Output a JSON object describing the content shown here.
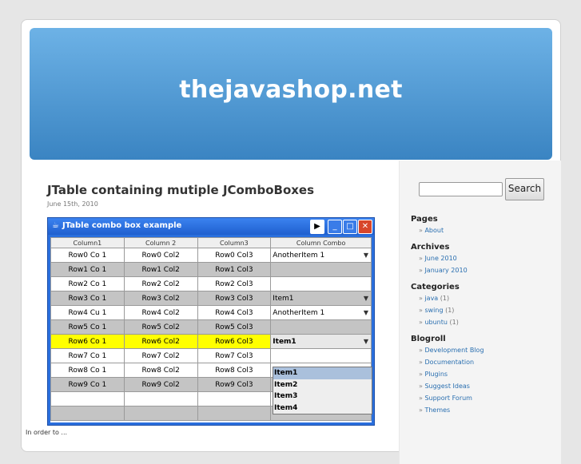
{
  "site": {
    "title": "thejavashop.net"
  },
  "post": {
    "title": "JTable containing mutiple JComboBoxes",
    "date": "June 15th, 2010",
    "body_excerpt": "In  order  to ..."
  },
  "app_window": {
    "title": "JTable combo box example",
    "columns": [
      "Column1",
      "Column 2",
      "Column3",
      "Column Combo"
    ],
    "rows": [
      [
        "Row0 Co 1",
        "Row0 Col2",
        "Row0 Col3",
        "AnotherItem 1"
      ],
      [
        "Row1 Co 1",
        "Row1 Col2",
        "Row1 Col3",
        ""
      ],
      [
        "Row2 Co 1",
        "Row2 Col2",
        "Row2 Col3",
        ""
      ],
      [
        "Row3 Co 1",
        "Row3 Col2",
        "Row3 Col3",
        "Item1"
      ],
      [
        "Row4 Cu 1",
        "Row4 Col2",
        "Row4 Col3",
        "AnotherItem 1"
      ],
      [
        "Row5 Co 1",
        "Row5 Col2",
        "Row5 Col3",
        ""
      ],
      [
        "Row6 Co 1",
        "Row6 Col2",
        "Row6 Col3",
        "Item1"
      ],
      [
        "Row7 Co 1",
        "Row7 Col2",
        "Row7 Col3",
        ""
      ],
      [
        "Row8 Co 1",
        "Row8 Col2",
        "Row8 Col3",
        ""
      ],
      [
        "Row9 Co 1",
        "Row9 Col2",
        "Row9 Col3",
        ""
      ]
    ],
    "dropdown_items": [
      "Item1",
      "Item2",
      "Item3",
      "Item4"
    ],
    "highlight_color": "#ffff00"
  },
  "sidebar": {
    "search_button": "Search",
    "search_placeholder": "",
    "sections": [
      {
        "heading": "Pages",
        "items": [
          {
            "label": "About",
            "count": ""
          }
        ]
      },
      {
        "heading": "Archives",
        "items": [
          {
            "label": "June 2010",
            "count": ""
          },
          {
            "label": "January 2010",
            "count": ""
          }
        ]
      },
      {
        "heading": "Categories",
        "items": [
          {
            "label": "java",
            "count": "(1)"
          },
          {
            "label": "swing",
            "count": "(1)"
          },
          {
            "label": "ubuntu",
            "count": "(1)"
          }
        ]
      },
      {
        "heading": "Blogroll",
        "items": [
          {
            "label": "Development Blog",
            "count": ""
          },
          {
            "label": "Documentation",
            "count": ""
          },
          {
            "label": "Plugins",
            "count": ""
          },
          {
            "label": "Suggest Ideas",
            "count": ""
          },
          {
            "label": "Support Forum",
            "count": ""
          },
          {
            "label": "Themes",
            "count": ""
          }
        ]
      }
    ]
  },
  "colors": {
    "header_top": "#6db2e6",
    "header_bottom": "#3a84c2",
    "link": "#2a6fb0"
  }
}
